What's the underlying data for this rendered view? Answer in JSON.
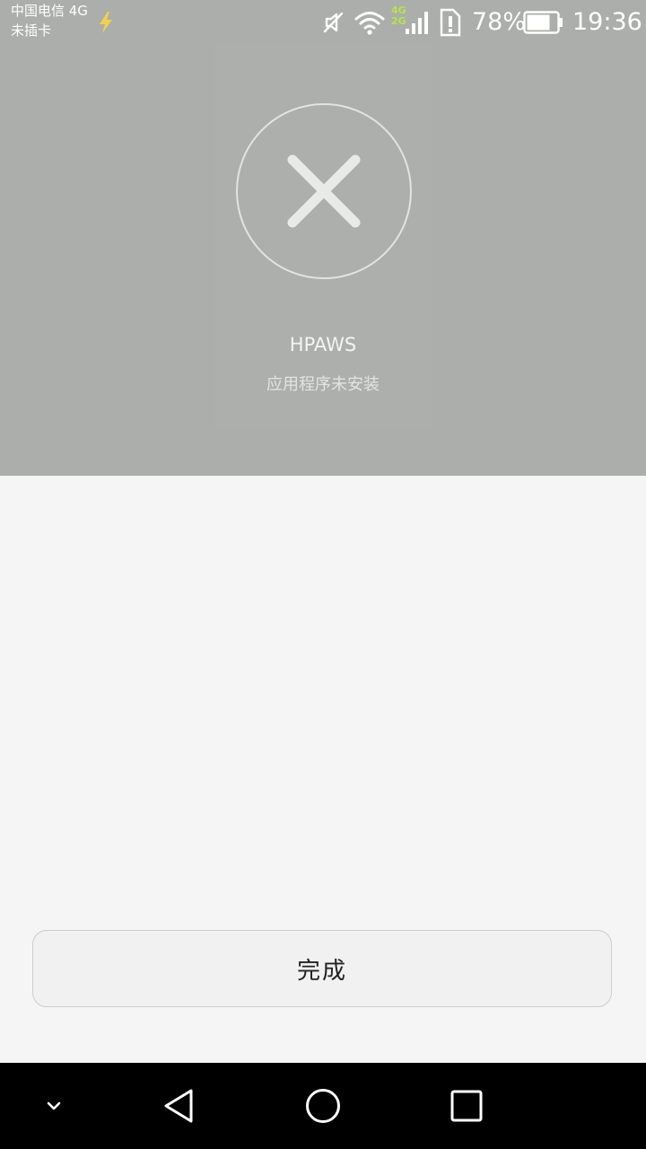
{
  "status_bar": {
    "carrier_line1": "中国电信 4G",
    "carrier_line2": "未插卡",
    "network_type": [
      "4G",
      "2G"
    ],
    "battery_percent": "78%",
    "time": "19:36",
    "icons": [
      "charging-icon",
      "mute-icon",
      "wifi-icon",
      "signal-icon",
      "sim-alert-icon",
      "battery-icon"
    ],
    "accent_color": "#b9e34a",
    "battery_level": 0.78
  },
  "result": {
    "icon": "close-icon",
    "app_name": "HPAWS",
    "status_text": "应用程序未安装",
    "header_color": "#abaeaa"
  },
  "actions": {
    "done_label": "完成"
  },
  "nav_bar": {
    "icons": [
      "chevron-down-icon",
      "back-icon",
      "home-icon",
      "recent-apps-icon"
    ]
  }
}
